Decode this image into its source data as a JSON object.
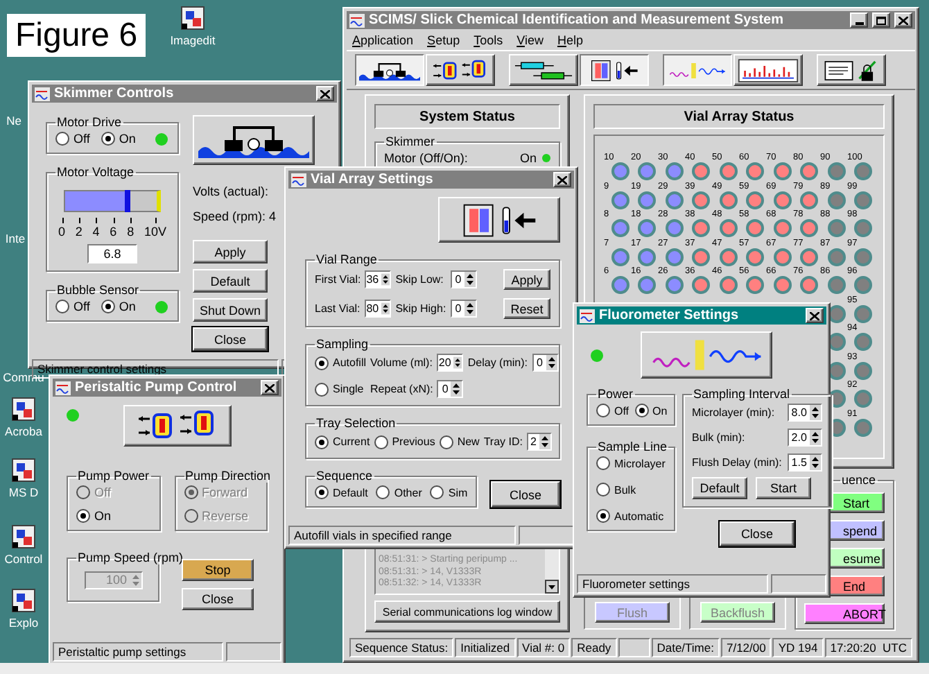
{
  "figure_label": "Figure 6",
  "desktop_icons": [
    {
      "label": "Imagedit"
    },
    {
      "label": "Ne"
    },
    {
      "label": "Inte"
    },
    {
      "label": "Commu"
    },
    {
      "label": "Acroba"
    },
    {
      "label": "MS D"
    },
    {
      "label": "Control"
    },
    {
      "label": "Explo"
    }
  ],
  "main_window": {
    "title": "SCIMS/ Slick Chemical Identification and Measurement System",
    "active": false,
    "menu": [
      "Application",
      "Setup",
      "Tools",
      "View",
      "Help"
    ],
    "toolbar_groups": [
      {
        "buttons": [
          {
            "kind": "skimmer",
            "pressed": true
          },
          {
            "kind": "pump",
            "pressed": false
          }
        ]
      },
      {
        "buttons": [
          {
            "kind": "syringe",
            "pressed": false
          },
          {
            "kind": "vial-array",
            "pressed": true
          }
        ]
      },
      {
        "buttons": [
          {
            "kind": "fluorometer",
            "pressed": true
          },
          {
            "kind": "chart",
            "pressed": false
          }
        ]
      },
      {
        "buttons": [
          {
            "kind": "log",
            "pressed": false
          }
        ]
      }
    ],
    "system_status": {
      "title": "System Status",
      "skimmer": {
        "label": "Skimmer",
        "rows": [
          {
            "label": "Motor (Off/On):",
            "value": "On",
            "on": true
          }
        ]
      }
    },
    "log": {
      "lines": [
        "08:51:31: > Starting peripump ...",
        "08:51:31: > 14, V1333R",
        "08:51:32: > 14, V1333R"
      ],
      "button": "Serial communications log window"
    },
    "vial_status": {
      "title": "Vial Array Status",
      "columns": [
        {
          "color": "#8c8cff",
          "vials": [
            "10",
            "9",
            "8",
            "7",
            "6"
          ]
        },
        {
          "color": "#8c8cff",
          "vials": [
            "20",
            "19",
            "18",
            "17",
            "16"
          ]
        },
        {
          "color": "#8c8cff",
          "vials": [
            "30",
            "29",
            "28",
            "27",
            "26"
          ]
        },
        {
          "color": "#ff8080",
          "vials": [
            "40",
            "39",
            "38",
            "37",
            "36"
          ]
        },
        {
          "color": "#ff8080",
          "vials": [
            "50",
            "49",
            "48",
            "47",
            "46"
          ]
        },
        {
          "color": "#ff8080",
          "vials": [
            "60",
            "59",
            "58",
            "57",
            "56"
          ]
        },
        {
          "color": "#ff8080",
          "vials": [
            "70",
            "69",
            "68",
            "67",
            "66"
          ]
        },
        {
          "color": "#ff8080",
          "vials": [
            "80",
            "79",
            "78",
            "77",
            "76"
          ]
        },
        {
          "color": "#808080",
          "vials": [
            "90",
            "89",
            "88",
            "87",
            "86"
          ]
        },
        {
          "color": "#808080",
          "vials": [
            "100",
            "99",
            "98",
            "97",
            "96",
            "95",
            "94",
            "93",
            "92",
            "91"
          ]
        }
      ]
    },
    "flush_buttons": [
      {
        "label": "Flush",
        "color": "#c8c8ff",
        "disabled": true
      },
      {
        "label": "Backflush",
        "color": "#c8ffc8",
        "disabled": true
      }
    ],
    "sequence": {
      "label": "uence",
      "buttons": [
        {
          "label": "Start",
          "color": "#80ff80"
        },
        {
          "label": "spend",
          "color": "#c0c0ff"
        },
        {
          "label": "esume",
          "color": "#c0ffc0"
        },
        {
          "label": "End",
          "color": "#ff8080"
        },
        {
          "label": "ABORT",
          "color": "#ff80ff"
        }
      ]
    },
    "status_bar": [
      {
        "kind": "text",
        "text": "Sequence Status:"
      },
      {
        "kind": "text",
        "text": "Initialized"
      },
      {
        "kind": "text",
        "text": "Vial #: 0"
      },
      {
        "kind": "text",
        "text": "Ready"
      },
      {
        "kind": "blank"
      },
      {
        "kind": "text",
        "text": "Date/Time:"
      },
      {
        "kind": "text",
        "text": "7/12/00"
      },
      {
        "kind": "text",
        "text": "YD 194"
      },
      {
        "kind": "text",
        "text": "17:20:20  UTC"
      }
    ]
  },
  "skimmer": {
    "title": "Skimmer Controls",
    "active": false,
    "motor_drive": {
      "label": "Motor Drive",
      "led_on": true,
      "options": [
        {
          "label": "Off",
          "selected": false
        },
        {
          "label": "On",
          "selected": true
        }
      ]
    },
    "motor_voltage": {
      "label": "Motor Voltage",
      "level": 0.68,
      "ticks": [
        "0",
        "2",
        "4",
        "6",
        "8",
        "10V"
      ],
      "value": "6.8"
    },
    "bubble_sensor": {
      "label": "Bubble Sensor",
      "led_on": true,
      "options": [
        {
          "label": "Off",
          "selected": false
        },
        {
          "label": "On",
          "selected": true
        }
      ]
    },
    "volts_label": "Volts (actual):",
    "speed_label": "Speed (rpm): 4",
    "buttons": [
      "Apply",
      "Default",
      "Shut Down",
      "Close"
    ],
    "status": "Skimmer control settings"
  },
  "vial_settings": {
    "title": "Vial Array Settings",
    "active": false,
    "vial_range": {
      "label": "Vial Range",
      "fields": [
        {
          "label": "First Vial:",
          "value": "36"
        },
        {
          "label": "Skip Low:",
          "value": "0"
        },
        {
          "label": "Last Vial:",
          "value": "80"
        },
        {
          "label": "Skip High:",
          "value": "0"
        }
      ],
      "buttons": [
        "Apply",
        "Reset"
      ]
    },
    "sampling": {
      "label": "Sampling",
      "modes": [
        {
          "label": "Autofill",
          "selected": true
        },
        {
          "label": "Single",
          "selected": false
        }
      ],
      "fields": [
        {
          "label": "Volume (ml):",
          "value": "20"
        },
        {
          "label": "Delay (min):",
          "value": "0"
        },
        {
          "label": "Repeat (xN):",
          "value": "0"
        }
      ]
    },
    "tray": {
      "label": "Tray Selection",
      "options": [
        {
          "label": "Current",
          "selected": true
        },
        {
          "label": "Previous",
          "selected": false
        },
        {
          "label": "New",
          "selected": false
        }
      ],
      "tray_id": {
        "label": "Tray ID:",
        "value": "2"
      }
    },
    "sequence": {
      "label": "Sequence",
      "options": [
        {
          "label": "Default",
          "selected": true
        },
        {
          "label": "Other",
          "selected": false
        },
        {
          "label": "Sim",
          "selected": false
        }
      ]
    },
    "close": "Close",
    "status": "Autofill vials in specified range"
  },
  "fluorometer": {
    "title": "Fluorometer Settings",
    "active": true,
    "led_on": true,
    "power": {
      "label": "Power",
      "options": [
        {
          "label": "Off",
          "selected": false
        },
        {
          "label": "On",
          "selected": true
        }
      ]
    },
    "sample_line": {
      "label": "Sample Line",
      "options": [
        {
          "label": "Microlayer",
          "selected": false
        },
        {
          "label": "Bulk",
          "selected": false
        },
        {
          "label": "Automatic",
          "selected": true
        }
      ]
    },
    "interval": {
      "label": "Sampling Interval",
      "fields": [
        {
          "label": "Microlayer (min):",
          "value": "8.0"
        },
        {
          "label": "Bulk (min):",
          "value": "2.0"
        },
        {
          "label": "Flush Delay (min):",
          "value": "1.5"
        }
      ],
      "buttons": [
        "Default",
        "Start"
      ]
    },
    "close": "Close",
    "status": "Fluorometer settings"
  },
  "pump": {
    "title": "Peristaltic Pump Control",
    "active": false,
    "led_on": true,
    "power": {
      "label": "Pump Power",
      "options": [
        {
          "label": "Off",
          "selected": false,
          "disabled": true
        },
        {
          "label": "On",
          "selected": true,
          "disabled": false
        }
      ]
    },
    "direction": {
      "label": "Pump Direction",
      "options": [
        {
          "label": "Forward",
          "selected": true,
          "disabled": true
        },
        {
          "label": "Reverse",
          "selected": false,
          "disabled": true
        }
      ]
    },
    "speed": {
      "label": "Pump Speed (rpm)",
      "value": "100",
      "disabled": true
    },
    "buttons": [
      {
        "label": "Stop",
        "kind": "warning"
      },
      {
        "label": "Close",
        "kind": "normal"
      }
    ],
    "status": "Peristaltic pump settings"
  }
}
